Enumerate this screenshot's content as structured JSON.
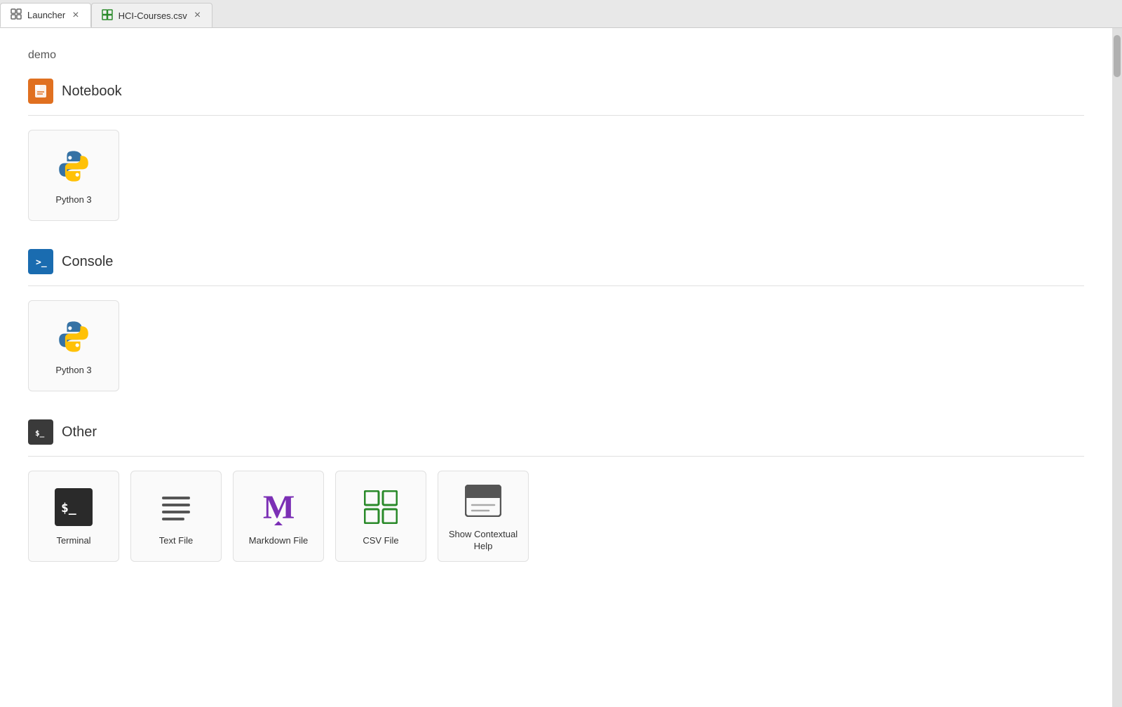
{
  "tabs": [
    {
      "id": "launcher",
      "label": "Launcher",
      "icon": "launcher-icon",
      "active": true,
      "closeable": true
    },
    {
      "id": "hci-courses",
      "label": "HCI-Courses.csv",
      "icon": "csv-tab-icon",
      "active": false,
      "closeable": true
    }
  ],
  "launcher": {
    "directory": "demo",
    "sections": [
      {
        "id": "notebook",
        "title": "Notebook",
        "icon_type": "orange",
        "items": [
          {
            "id": "python3-notebook",
            "label": "Python 3",
            "icon_type": "python"
          }
        ]
      },
      {
        "id": "console",
        "title": "Console",
        "icon_type": "blue",
        "items": [
          {
            "id": "python3-console",
            "label": "Python 3",
            "icon_type": "python"
          }
        ]
      },
      {
        "id": "other",
        "title": "Other",
        "icon_type": "dark",
        "items": [
          {
            "id": "terminal",
            "label": "Terminal",
            "icon_type": "terminal"
          },
          {
            "id": "text-file",
            "label": "Text File",
            "icon_type": "textfile"
          },
          {
            "id": "markdown-file",
            "label": "Markdown File",
            "icon_type": "markdown"
          },
          {
            "id": "csv-file",
            "label": "CSV File",
            "icon_type": "csv"
          },
          {
            "id": "show-contextual-help",
            "label": "Show Contextual Help",
            "icon_type": "help"
          }
        ]
      }
    ]
  }
}
